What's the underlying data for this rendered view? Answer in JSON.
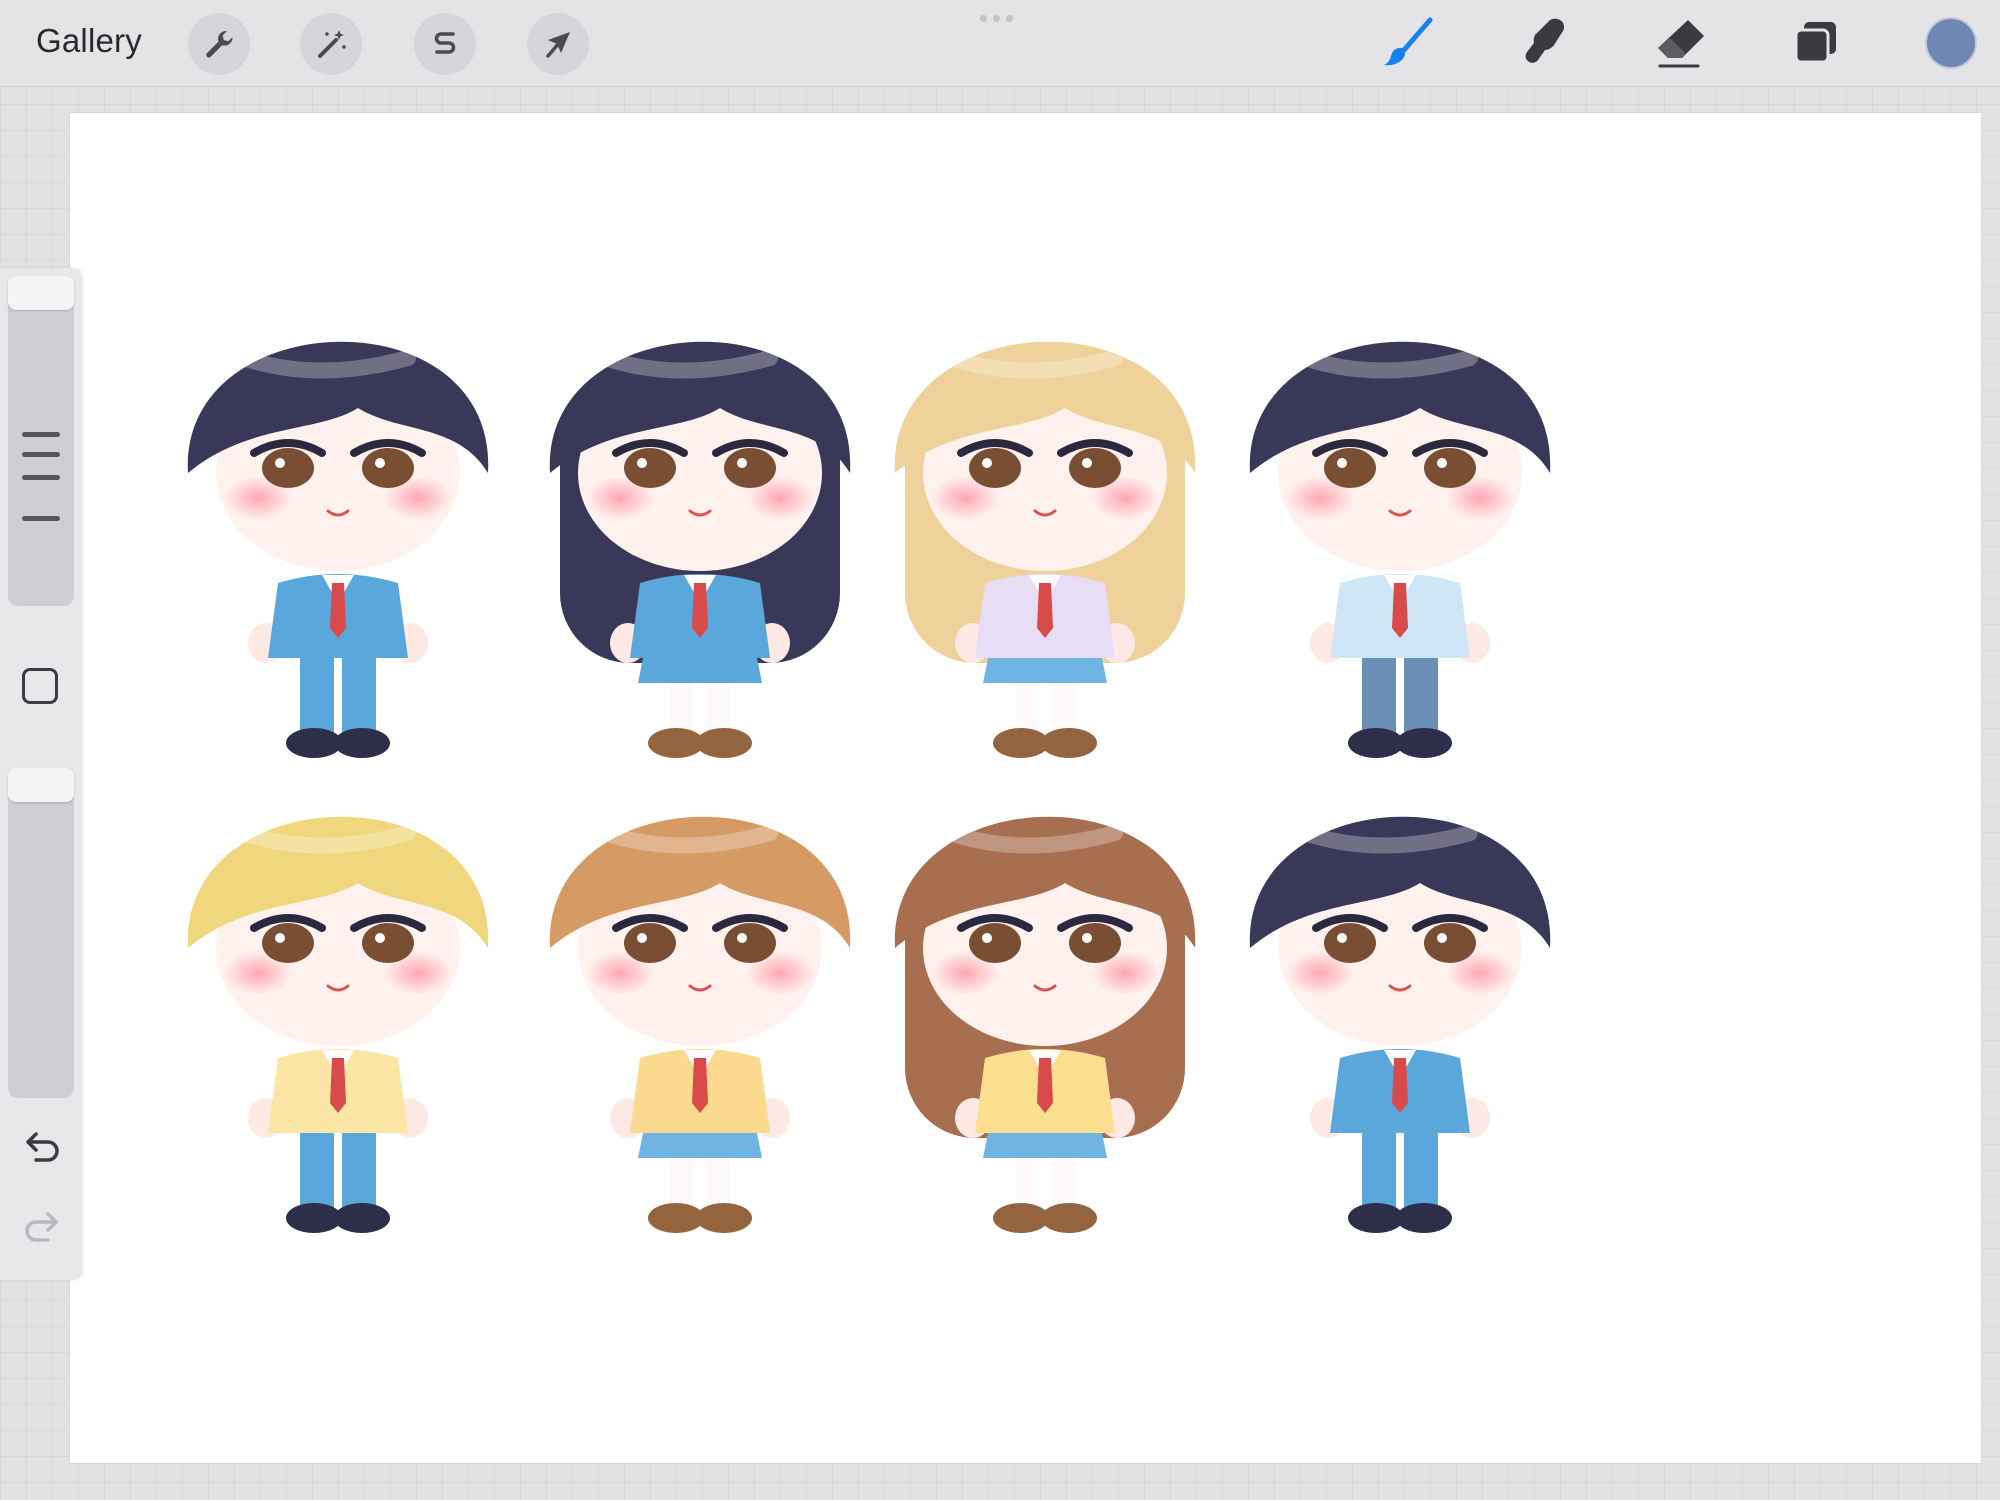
{
  "toolbar": {
    "gallery_label": "Gallery",
    "left_tools": [
      {
        "name": "actions",
        "icon": "wrench-icon"
      },
      {
        "name": "adjustments",
        "icon": "magic-wand-icon"
      },
      {
        "name": "selection",
        "icon": "selection-s-icon"
      },
      {
        "name": "transform",
        "icon": "arrow-cursor-icon"
      }
    ],
    "right_tools": [
      {
        "name": "brush",
        "icon": "brush-icon",
        "active": true
      },
      {
        "name": "smudge",
        "icon": "smudge-finger-icon",
        "active": false
      },
      {
        "name": "eraser",
        "icon": "eraser-icon",
        "active": false
      },
      {
        "name": "layers",
        "icon": "layers-icon",
        "active": false
      }
    ],
    "current_color": "#7086b4",
    "accent_color": "#1a7ff0"
  },
  "sidebar": {
    "brush_size_level": 0.0,
    "brush_opacity_level": 0.0,
    "buttons": [
      {
        "name": "modify",
        "icon": "square-icon"
      },
      {
        "name": "undo",
        "icon": "undo-icon"
      },
      {
        "name": "redo",
        "icon": "redo-icon",
        "enabled": false
      }
    ]
  },
  "canvas": {
    "background": "#ffffff",
    "characters": [
      {
        "hair": "#3a3858",
        "style": "boy",
        "outfit": "blue-blazer"
      },
      {
        "hair": "#3a3858",
        "style": "girl-long",
        "outfit": "blue-cardigan"
      },
      {
        "hair": "#efd299",
        "style": "girl-wavy",
        "outfit": "lavender-cardigan"
      },
      {
        "hair": "#3a3858",
        "style": "boy",
        "outfit": "pale-blue-shirt"
      },
      {
        "hair": "#f0d77d",
        "style": "boy-messy",
        "outfit": "yellow-cardigan"
      },
      {
        "hair": "#d69a65",
        "style": "girl-bob",
        "outfit": "yellow-sweater"
      },
      {
        "hair": "#a76e4f",
        "style": "girl-long",
        "outfit": "yellow-vest"
      },
      {
        "hair": "#3a3858",
        "style": "boy-short",
        "outfit": "blue-blazer"
      }
    ]
  }
}
